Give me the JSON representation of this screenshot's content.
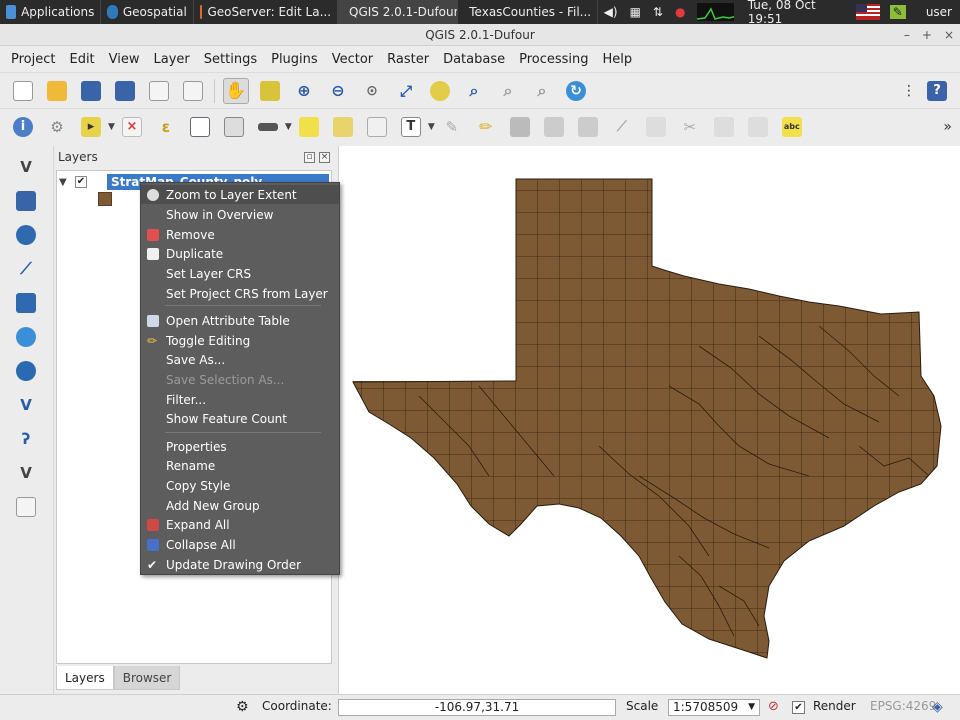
{
  "taskbar": {
    "applications": "Applications",
    "geospatial": "Geospatial",
    "geoserver": "GeoServer: Edit La...",
    "qgis": "QGIS 2.0.1-Dufour",
    "files": "TexasCounties - Fil...",
    "clock": "Tue, 08 Oct  19:51",
    "user": "user"
  },
  "window": {
    "title": "QGIS 2.0.1-Dufour"
  },
  "menubar": [
    "Project",
    "Edit",
    "View",
    "Layer",
    "Settings",
    "Plugins",
    "Vector",
    "Raster",
    "Database",
    "Processing",
    "Help"
  ],
  "layers_panel": {
    "title": "Layers",
    "layer_name": "StratMap_County_poly",
    "tabs": [
      "Layers",
      "Browser"
    ]
  },
  "context_menu": {
    "items": [
      {
        "label": "Zoom to Layer Extent",
        "icon": "zoom-layer-icon",
        "icon_color": "#dddddd"
      },
      {
        "label": "Show in Overview",
        "icon": "",
        "icon_color": ""
      },
      {
        "label": "Remove",
        "icon": "remove-icon",
        "icon_color": "#e05050"
      },
      {
        "label": "Duplicate",
        "icon": "duplicate-icon",
        "icon_color": "#f0f0f0"
      },
      {
        "label": "Set Layer CRS",
        "icon": "",
        "icon_color": ""
      },
      {
        "label": "Set Project CRS from Layer",
        "icon": "",
        "icon_color": ""
      },
      {
        "label": "Open Attribute Table",
        "icon": "table-icon",
        "icon_color": "#cfd8e6"
      },
      {
        "label": "Toggle Editing",
        "icon": "pencil-icon",
        "icon_color": "#e8c84a"
      },
      {
        "label": "Save As...",
        "icon": "",
        "icon_color": ""
      },
      {
        "label": "Save Selection As...",
        "icon": "",
        "icon_color": "",
        "disabled": true
      },
      {
        "label": "Filter...",
        "icon": "",
        "icon_color": ""
      },
      {
        "label": "Show Feature Count",
        "icon": "",
        "icon_color": ""
      },
      {
        "label": "Properties",
        "icon": "",
        "icon_color": ""
      },
      {
        "label": "Rename",
        "icon": "",
        "icon_color": ""
      },
      {
        "label": "Copy Style",
        "icon": "",
        "icon_color": ""
      },
      {
        "label": "Add New Group",
        "icon": "",
        "icon_color": ""
      },
      {
        "label": "Expand All",
        "icon": "expand-icon",
        "icon_color": "#d04848"
      },
      {
        "label": "Collapse All",
        "icon": "collapse-icon",
        "icon_color": "#4870c8"
      },
      {
        "label": "Update Drawing Order",
        "icon": "check-icon",
        "icon_color": "#ffffff"
      }
    ]
  },
  "statusbar": {
    "coordinate_label": "Coordinate:",
    "coordinate_value": "-106.97,31.71",
    "scale_label": "Scale",
    "scale_value": "1:5708509",
    "render_label": "Render",
    "crs": "EPSG:4269"
  },
  "colors": {
    "county_fill": "#7d5a34",
    "county_stroke": "#2a1c0e",
    "selection": "#3b7ac9",
    "menu_bg": "#5d5d5d"
  }
}
